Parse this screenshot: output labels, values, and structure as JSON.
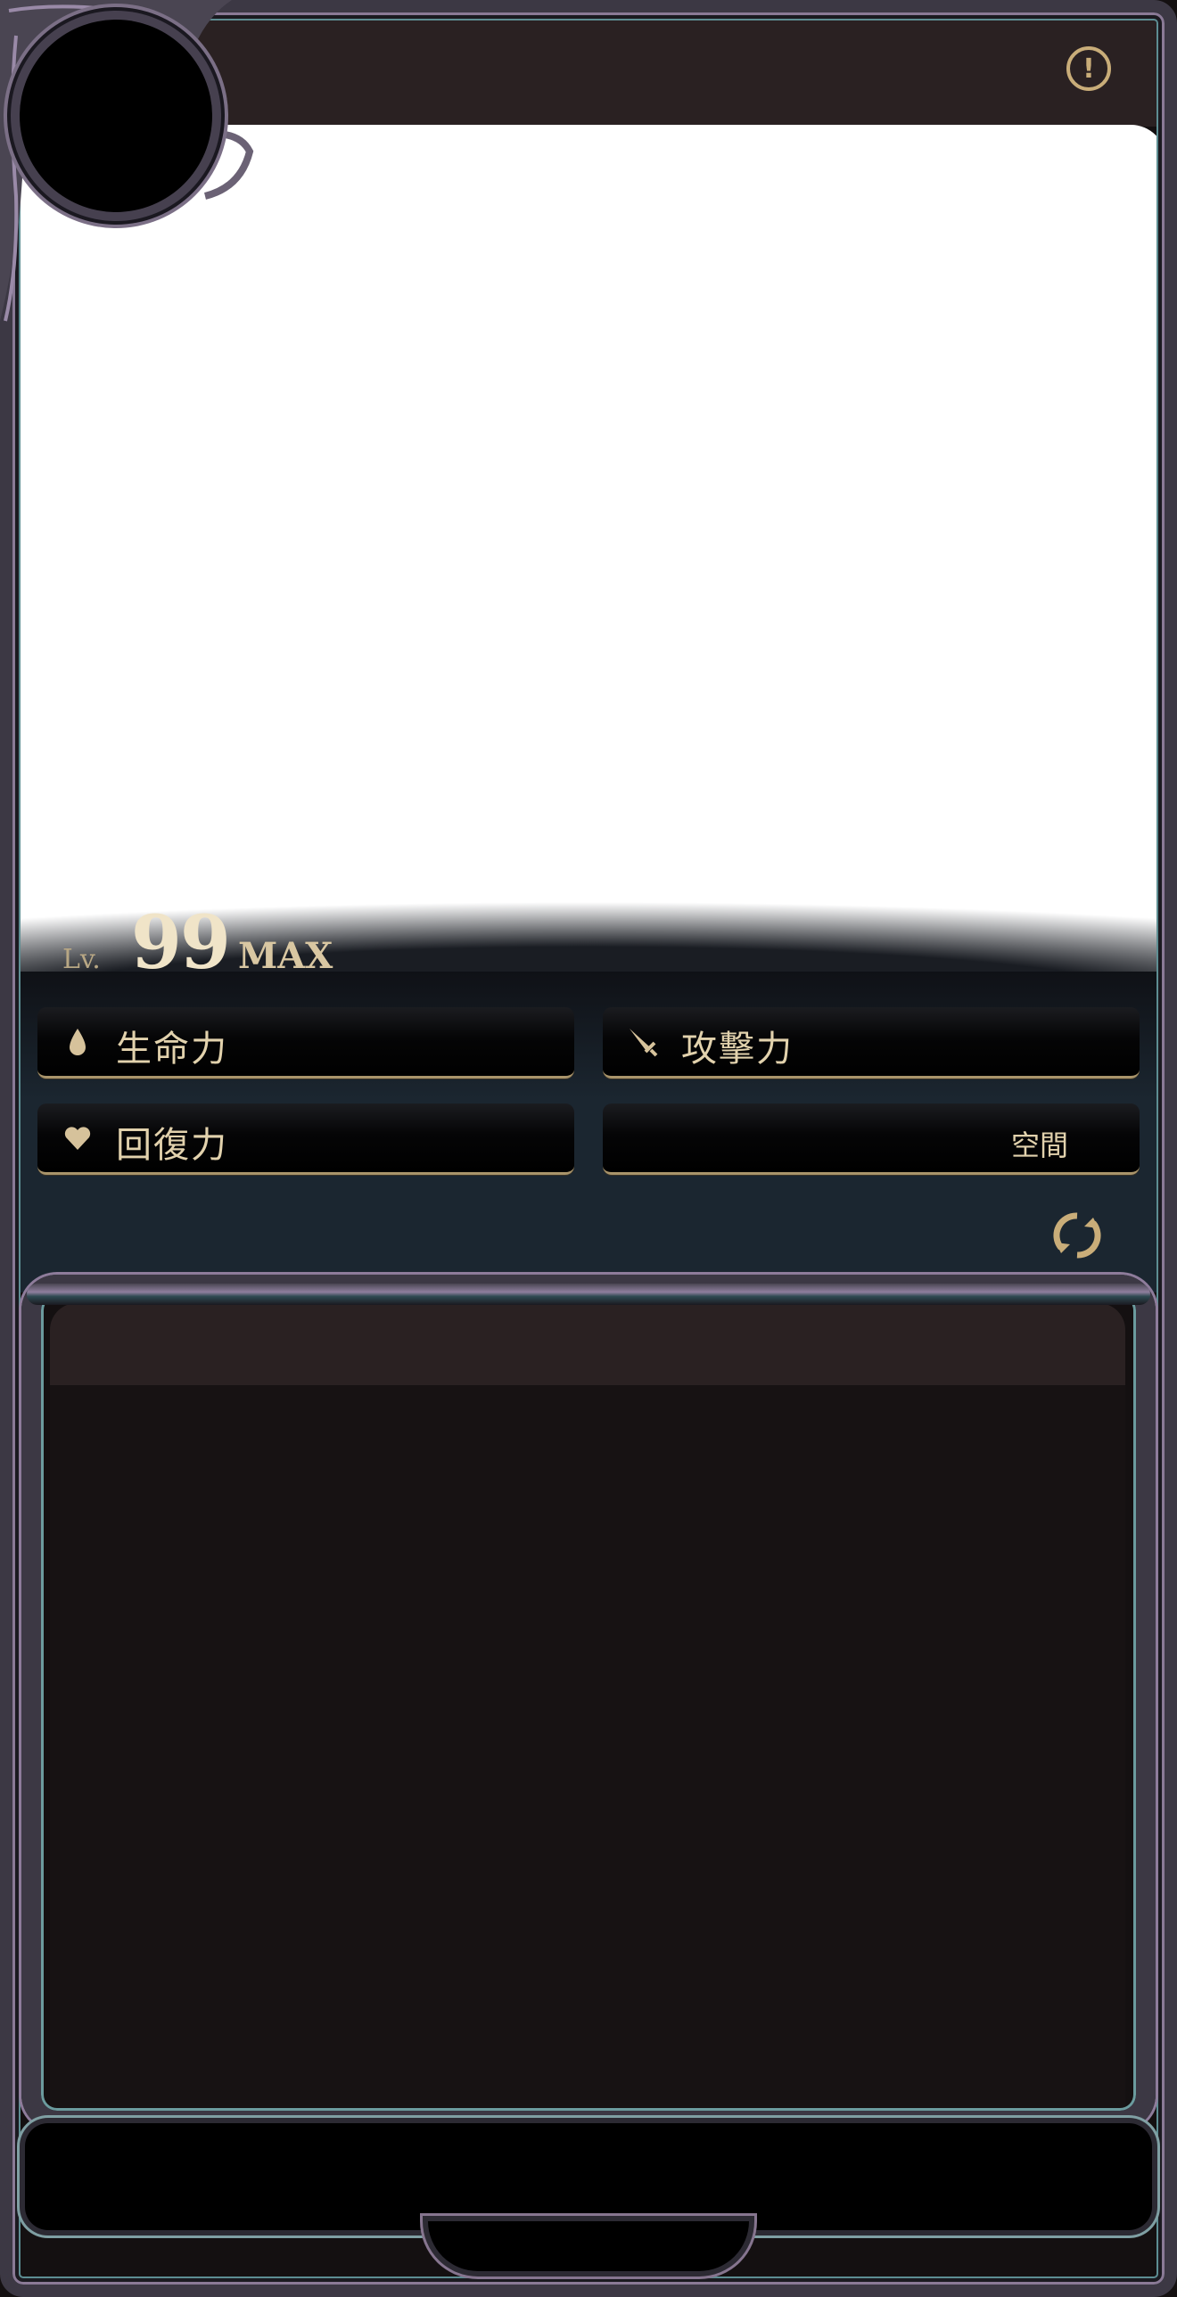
{
  "level": {
    "prefix": "Lv.",
    "value": "99",
    "suffix": "MAX"
  },
  "stats": [
    {
      "label": "生命力",
      "icon": "drop-icon",
      "value": ""
    },
    {
      "label": "攻擊力",
      "icon": "sword-icon",
      "value": ""
    },
    {
      "label": "回復力",
      "icon": "heart-icon",
      "value": ""
    },
    {
      "label": "",
      "icon": "",
      "value": "空間"
    }
  ],
  "header": {
    "info_icon": "!"
  },
  "colors": {
    "gold": "#c9ad79",
    "frame": "#3c3844",
    "panel": "#1b2630",
    "background": "#171213"
  }
}
